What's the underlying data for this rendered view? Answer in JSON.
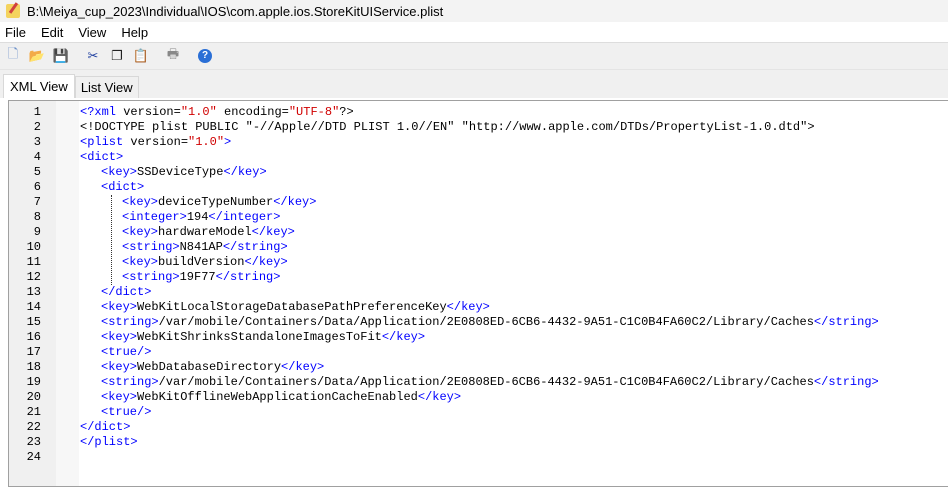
{
  "window": {
    "title": "B:\\Meiya_cup_2023\\Individual\\IOS\\com.apple.ios.StoreKitUIService.plist"
  },
  "menu": [
    "File",
    "Edit",
    "View",
    "Help"
  ],
  "toolbar": [
    "new-file-icon",
    "open-folder-icon",
    "save-icon",
    "cut-icon",
    "copy-icon",
    "paste-icon",
    "print-icon",
    "help-icon"
  ],
  "tabs": [
    {
      "label": "XML View",
      "active": true
    },
    {
      "label": "List View",
      "active": false
    }
  ],
  "colors": {
    "tag": "#0000ff",
    "text": "#000000",
    "value": "#d00000"
  },
  "lines": [
    {
      "n": "1",
      "i": 0,
      "t": [
        [
          "tag",
          "<?xml "
        ],
        [
          "txt",
          "version="
        ],
        [
          "val",
          "\"1.0\""
        ],
        [
          "txt",
          " encoding="
        ],
        [
          "val",
          "\"UTF-8\""
        ],
        [
          "txt",
          "?>"
        ]
      ]
    },
    {
      "n": "2",
      "i": 0,
      "t": [
        [
          "txt",
          "<!DOCTYPE plist PUBLIC \"-//Apple//DTD PLIST 1.0//EN\" \"http://www.apple.com/DTDs/PropertyList-1.0.dtd\">"
        ]
      ]
    },
    {
      "n": "3",
      "i": 0,
      "t": [
        [
          "tag",
          "<plist "
        ],
        [
          "txt",
          "version="
        ],
        [
          "val",
          "\"1.0\""
        ],
        [
          "tag",
          ">"
        ]
      ]
    },
    {
      "n": "4",
      "i": 0,
      "t": [
        [
          "tag",
          "<dict>"
        ]
      ]
    },
    {
      "n": "5",
      "i": 1,
      "t": [
        [
          "tag",
          "<key>"
        ],
        [
          "txt",
          "SSDeviceType"
        ],
        [
          "tag",
          "</key>"
        ]
      ]
    },
    {
      "n": "6",
      "i": 1,
      "t": [
        [
          "tag",
          "<dict>"
        ]
      ]
    },
    {
      "n": "7",
      "i": 2,
      "t": [
        [
          "tag",
          "<key>"
        ],
        [
          "txt",
          "deviceTypeNumber"
        ],
        [
          "tag",
          "</key>"
        ]
      ]
    },
    {
      "n": "8",
      "i": 2,
      "t": [
        [
          "tag",
          "<integer>"
        ],
        [
          "txt",
          "194"
        ],
        [
          "tag",
          "</integer>"
        ]
      ]
    },
    {
      "n": "9",
      "i": 2,
      "t": [
        [
          "tag",
          "<key>"
        ],
        [
          "txt",
          "hardwareModel"
        ],
        [
          "tag",
          "</key>"
        ]
      ]
    },
    {
      "n": "10",
      "i": 2,
      "t": [
        [
          "tag",
          "<string>"
        ],
        [
          "txt",
          "N841AP"
        ],
        [
          "tag",
          "</string>"
        ]
      ]
    },
    {
      "n": "11",
      "i": 2,
      "t": [
        [
          "tag",
          "<key>"
        ],
        [
          "txt",
          "buildVersion"
        ],
        [
          "tag",
          "</key>"
        ]
      ]
    },
    {
      "n": "12",
      "i": 2,
      "t": [
        [
          "tag",
          "<string>"
        ],
        [
          "txt",
          "19F77"
        ],
        [
          "tag",
          "</string>"
        ]
      ]
    },
    {
      "n": "13",
      "i": 1,
      "t": [
        [
          "tag",
          "</dict>"
        ]
      ]
    },
    {
      "n": "14",
      "i": 1,
      "t": [
        [
          "tag",
          "<key>"
        ],
        [
          "txt",
          "WebKitLocalStorageDatabasePathPreferenceKey"
        ],
        [
          "tag",
          "</key>"
        ]
      ]
    },
    {
      "n": "15",
      "i": 1,
      "t": [
        [
          "tag",
          "<string>"
        ],
        [
          "txt",
          "/var/mobile/Containers/Data/Application/2E0808ED-6CB6-4432-9A51-C1C0B4FA60C2/Library/Caches"
        ],
        [
          "tag",
          "</string>"
        ]
      ]
    },
    {
      "n": "16",
      "i": 1,
      "t": [
        [
          "tag",
          "<key>"
        ],
        [
          "txt",
          "WebKitShrinksStandaloneImagesToFit"
        ],
        [
          "tag",
          "</key>"
        ]
      ]
    },
    {
      "n": "17",
      "i": 1,
      "t": [
        [
          "tag",
          "<true/>"
        ]
      ]
    },
    {
      "n": "18",
      "i": 1,
      "t": [
        [
          "tag",
          "<key>"
        ],
        [
          "txt",
          "WebDatabaseDirectory"
        ],
        [
          "tag",
          "</key>"
        ]
      ]
    },
    {
      "n": "19",
      "i": 1,
      "t": [
        [
          "tag",
          "<string>"
        ],
        [
          "txt",
          "/var/mobile/Containers/Data/Application/2E0808ED-6CB6-4432-9A51-C1C0B4FA60C2/Library/Caches"
        ],
        [
          "tag",
          "</string>"
        ]
      ]
    },
    {
      "n": "20",
      "i": 1,
      "t": [
        [
          "tag",
          "<key>"
        ],
        [
          "txt",
          "WebKitOfflineWebApplicationCacheEnabled"
        ],
        [
          "tag",
          "</key>"
        ]
      ]
    },
    {
      "n": "21",
      "i": 1,
      "t": [
        [
          "tag",
          "<true/>"
        ]
      ]
    },
    {
      "n": "22",
      "i": 0,
      "t": [
        [
          "tag",
          "</dict>"
        ]
      ]
    },
    {
      "n": "23",
      "i": 0,
      "t": [
        [
          "tag",
          "</plist>"
        ]
      ]
    },
    {
      "n": "24",
      "i": 0,
      "t": []
    }
  ]
}
